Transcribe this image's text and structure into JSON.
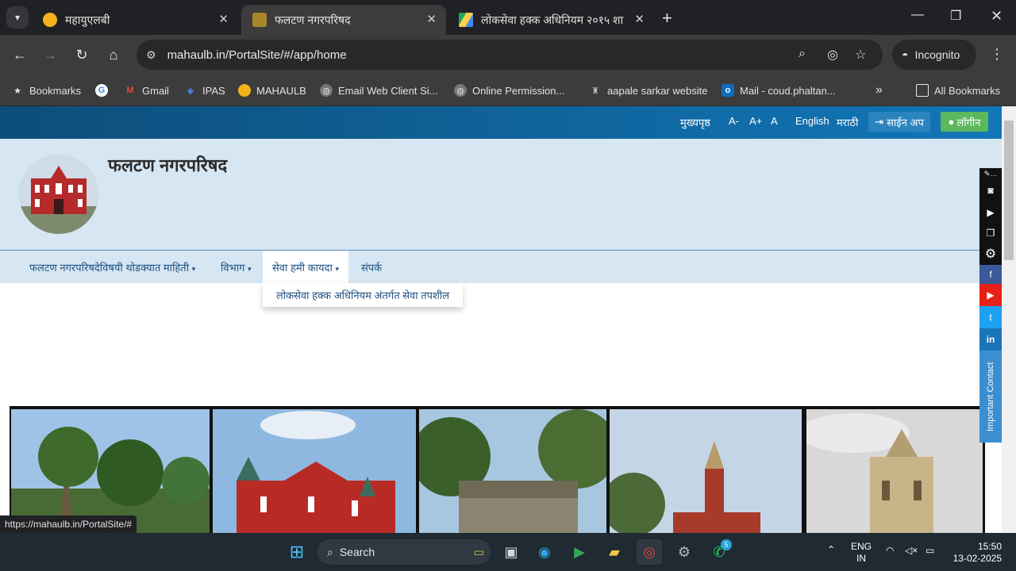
{
  "browser": {
    "tabs": [
      {
        "title": "महायुएलबी",
        "active": false
      },
      {
        "title": "फलटण नगरपरिषद",
        "active": true
      },
      {
        "title": "लोकसेवा हक्क अधिनियम २०१५ शा",
        "active": false
      }
    ],
    "url": "mahaulb.in/PortalSite/#/app/home",
    "incognito_label": "Incognito",
    "bookmarks": [
      "Bookmarks",
      "Gmail",
      "IPAS",
      "MAHAULB",
      "Email Web Client Si...",
      "Online Permission...",
      "aapale sarkar website",
      "Mail - coud.phaltan..."
    ],
    "all_bookmarks_label": "All Bookmarks",
    "status_url": "https://mahaulb.in/PortalSite/#"
  },
  "site": {
    "topbar": {
      "home": "मुख्यपृष्ठ",
      "font_decrease": "A-",
      "font_increase": "A+",
      "font_normal": "A",
      "english": "English",
      "marathi": "मराठी",
      "signup": "साईन अप",
      "login": "लॉगीन"
    },
    "title": "फलटण नगरपरिषद",
    "menu": [
      "फलटण नगरपरिषदेविषयी थोडक्यात माहिती",
      "विभाग",
      "सेवा हमी कायदा",
      "संपर्क"
    ],
    "dropdown_item": "लोकसेवा हक्क अधिनियम अंतर्गत सेवा तपशील",
    "important_contact": "Important Contact"
  },
  "taskbar": {
    "search": "Search",
    "lang1": "ENG",
    "lang2": "IN",
    "time": "15:50",
    "date": "13-02-2025",
    "whatsapp_badge": "5"
  },
  "colors": {
    "topbar": "#0d4d7a",
    "header_bg": "#d6e6f2",
    "menu_text": "#1d4f82",
    "login_btn": "#5cb85c",
    "youtube": "#e62117",
    "twitter": "#1da1f2",
    "linkedin": "#1a75b8"
  }
}
